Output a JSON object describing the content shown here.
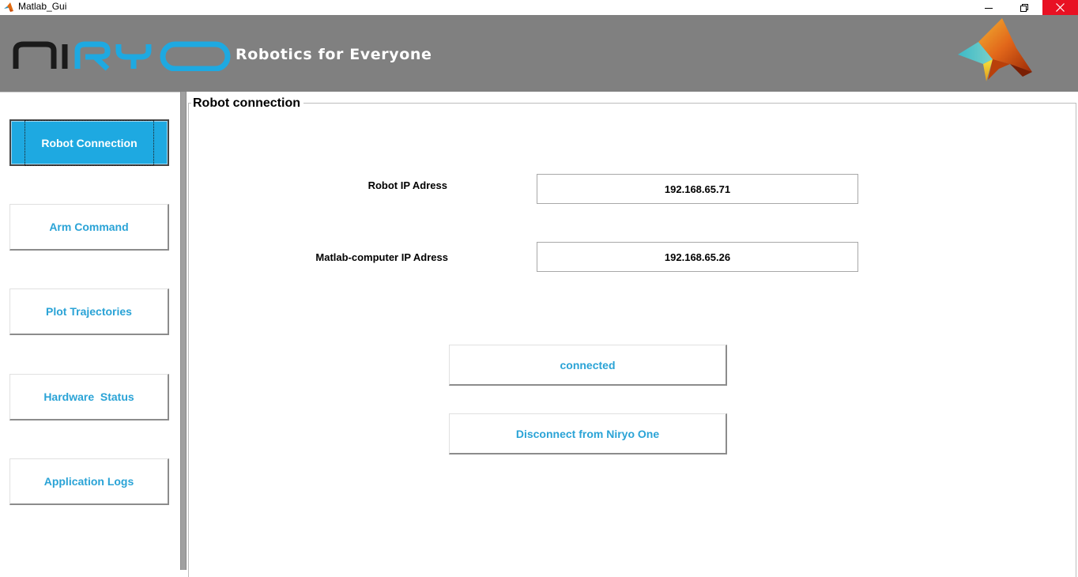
{
  "window": {
    "title": "Matlab_Gui",
    "controls": [
      "minimize",
      "restore",
      "close"
    ]
  },
  "header": {
    "logo_text": "NIRYO",
    "tagline": "Robotics for Everyone",
    "colors": {
      "banner": "#808080",
      "logo_dark": "#1a1a1a",
      "logo_blue": "#1ea9e1"
    }
  },
  "sidebar": {
    "items": [
      {
        "label": "Robot Connection",
        "active": true
      },
      {
        "label": "Arm Command",
        "active": false
      },
      {
        "label": "Plot Trajectories",
        "active": false
      },
      {
        "label": "Hardware  Status",
        "active": false
      },
      {
        "label": "Application Logs",
        "active": false
      }
    ],
    "colors": {
      "active_bg": "#1ea9e1",
      "label_blue": "#2aa3d6"
    }
  },
  "panel": {
    "title": "Robot connection",
    "robot_ip": {
      "label": "Robot IP Adress",
      "value": "192.168.65.71"
    },
    "computer_ip": {
      "label": "Matlab-computer IP Adress",
      "value": "192.168.65.26"
    },
    "status_button": "connected",
    "disconnect_button": "Disconnect from Niryo One"
  }
}
